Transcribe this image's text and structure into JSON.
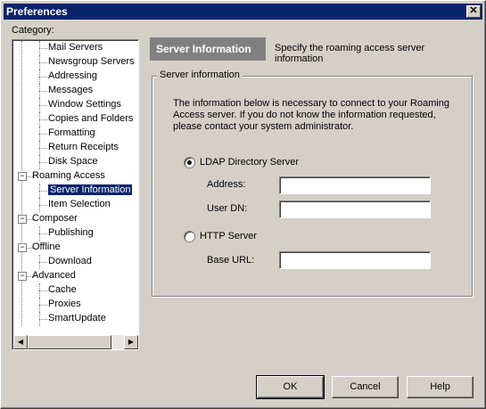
{
  "window": {
    "title": "Preferences",
    "close_label": "✕"
  },
  "category_label": "Category:",
  "tree": [
    {
      "label": "Mail Servers",
      "level": 2
    },
    {
      "label": "Newsgroup Servers",
      "level": 2
    },
    {
      "label": "Addressing",
      "level": 2
    },
    {
      "label": "Messages",
      "level": 2
    },
    {
      "label": "Window Settings",
      "level": 2
    },
    {
      "label": "Copies and Folders",
      "level": 2
    },
    {
      "label": "Formatting",
      "level": 2
    },
    {
      "label": "Return Receipts",
      "level": 2
    },
    {
      "label": "Disk Space",
      "level": 2
    },
    {
      "label": "Roaming Access",
      "level": 1,
      "expander": "−"
    },
    {
      "label": "Server Information",
      "level": 2,
      "selected": true
    },
    {
      "label": "Item Selection",
      "level": 2
    },
    {
      "label": "Composer",
      "level": 1,
      "expander": "−"
    },
    {
      "label": "Publishing",
      "level": 2
    },
    {
      "label": "Offline",
      "level": 1,
      "expander": "−"
    },
    {
      "label": "Download",
      "level": 2
    },
    {
      "label": "Advanced",
      "level": 1,
      "expander": "−"
    },
    {
      "label": "Cache",
      "level": 2
    },
    {
      "label": "Proxies",
      "level": 2
    },
    {
      "label": "SmartUpdate",
      "level": 2
    }
  ],
  "header": {
    "title": "Server Information",
    "subtitle": "Specify the roaming access server information"
  },
  "group": {
    "title": "Server information",
    "description": "The information below is necessary to connect to your Roaming Access server.  If you do not know the information requested, please contact your system administrator.",
    "ldap_label": "LDAP Directory Server",
    "ldap_selected": true,
    "address_label": "Address:",
    "address_value": "",
    "userdn_label": "User DN:",
    "userdn_value": "",
    "http_label": "HTTP Server",
    "http_selected": false,
    "baseurl_label": "Base URL:",
    "baseurl_value": ""
  },
  "buttons": {
    "ok": "OK",
    "cancel": "Cancel",
    "help": "Help"
  }
}
